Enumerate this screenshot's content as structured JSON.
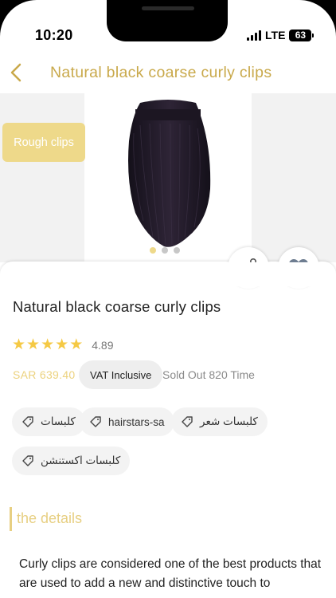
{
  "status": {
    "time": "10:20",
    "network": "LTE",
    "battery": "63"
  },
  "header": {
    "title": "Natural black coarse curly clips"
  },
  "gallery": {
    "badge": "Rough clips",
    "slide_count": 3,
    "active_slide": 1
  },
  "product": {
    "name": "Natural black coarse curly clips",
    "rating": "4.89",
    "stars": 5,
    "price": "SAR 639.40",
    "vat_label": "VAT Inclusive",
    "sold_text": "Sold Out 820 Time",
    "tags": [
      "كلبسات",
      "hairstars-sa",
      "كلبسات شعر",
      "كلبسات اكستنشن"
    ]
  },
  "details": {
    "title": "the details",
    "description": "Curly clips are considered one of the best products that are used to add a new and distinctive touch to"
  },
  "colors": {
    "accent": "#c9a94b",
    "badge": "#eed98a",
    "star": "#f5c944"
  },
  "icons": {
    "back": "chevron-left-icon",
    "share": "share-icon",
    "favorite": "heart-icon",
    "tag": "tag-icon"
  }
}
